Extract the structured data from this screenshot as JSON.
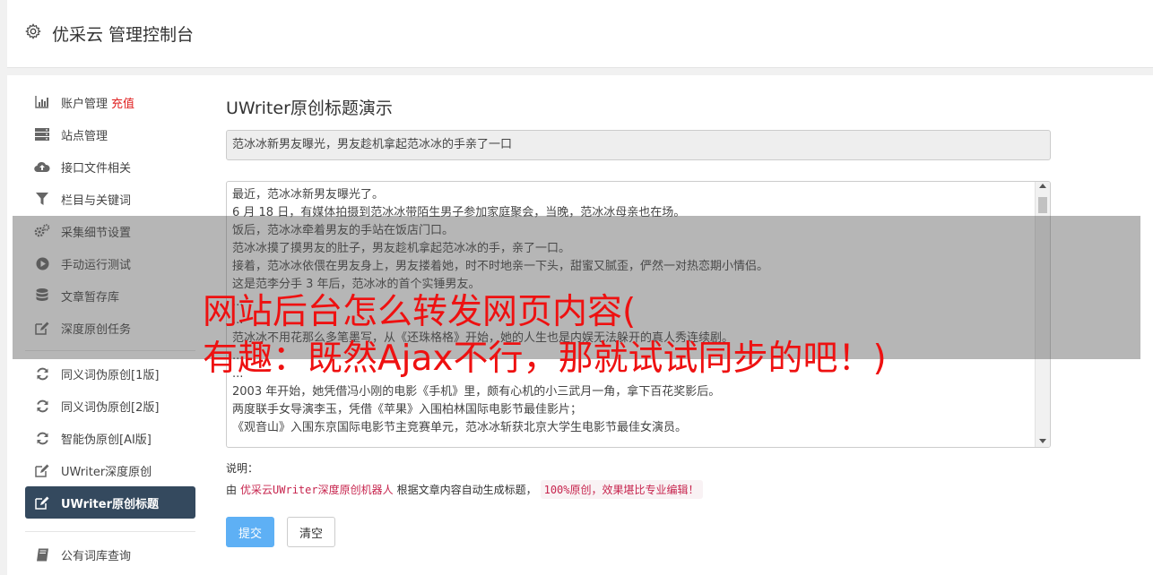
{
  "header": {
    "title": "优采云 管理控制台",
    "icon": "gear-icon"
  },
  "sidebar": {
    "items": [
      {
        "label": "账户管理",
        "badge": "充值",
        "icon": "bar-chart-icon"
      },
      {
        "label": "站点管理",
        "icon": "server-icon"
      },
      {
        "label": "接口文件相关",
        "icon": "cloud-upload-icon"
      },
      {
        "label": "栏目与关键词",
        "icon": "filter-icon"
      },
      {
        "label": "采集细节设置",
        "icon": "cogs-icon"
      },
      {
        "label": "手动运行测试",
        "icon": "play-circle-icon"
      },
      {
        "label": "文章暂存库",
        "icon": "database-icon"
      },
      {
        "label": "深度原创任务",
        "icon": "edit-icon"
      }
    ],
    "items2": [
      {
        "label": "同义词伪原创[1版]",
        "icon": "refresh-icon"
      },
      {
        "label": "同义词伪原创[2版]",
        "icon": "refresh-icon"
      },
      {
        "label": "智能伪原创[AI版]",
        "icon": "refresh-icon"
      },
      {
        "label": "UWriter深度原创",
        "icon": "edit-icon"
      },
      {
        "label": "UWriter原创标题",
        "icon": "edit-icon",
        "active": true
      }
    ],
    "items3": [
      {
        "label": "公有词库查询",
        "icon": "book-icon"
      }
    ]
  },
  "main": {
    "title": "UWriter原创标题演示",
    "title_input_value": "范冰冰新男友曝光，男友趁机拿起范冰冰的手亲了一口",
    "body_lines": [
      "最近，范冰冰新男友曝光了。",
      "6 月 18 日，有媒体拍摄到范冰冰带陌生男子参加家庭聚会，当晚，范冰冰母亲也在场。",
      "饭后，范冰冰牵着男友的手站在饭店门口。",
      "范冰冰摸了摸男友的肚子，男友趁机拿起范冰冰的手，亲了一口。",
      "接着，范冰冰依偎在男友身上，男友搂着她，时不时地亲一下头，甜蜜又腻歪，俨然一对热恋期小情侣。",
      "这是范李分手 3 年后，范冰冰的首个实锤男友。",
      "...",
      "...",
      "范冰冰不用花那么多笔墨写，从《还珠格格》开始，她的人生也是内娱无法躲开的真人秀连续剧。",
      "...",
      "...",
      "2003 年开始，她凭借冯小刚的电影《手机》里，颇有心机的小三武月一角，拿下百花奖影后。",
      "两度联手女导演李玉，凭借《苹果》入围柏林国际电影节最佳影片；",
      "《观音山》入围东京国际电影节主竞赛单元，范冰冰斩获北京大学生电影节最佳女演员。"
    ],
    "note_label": "说明：",
    "note_prefix": "由",
    "note_link": "优采云UWriter深度原创机器人",
    "note_middle": "根据文章内容自动生成标题，",
    "note_code": "100%原创，效果堪比专业编辑！",
    "submit_label": "提交",
    "clear_label": "清空"
  },
  "overlay": {
    "line1": "网站后台怎么转发网页内容(",
    "line2": "有趣：既然Ajax不行，那就试试同步的吧！)"
  },
  "colors": {
    "active_bg": "#34495e",
    "submit_bg": "#5eb0f5",
    "overlay_text": "#ee1111",
    "note_code": "#c7254e"
  }
}
